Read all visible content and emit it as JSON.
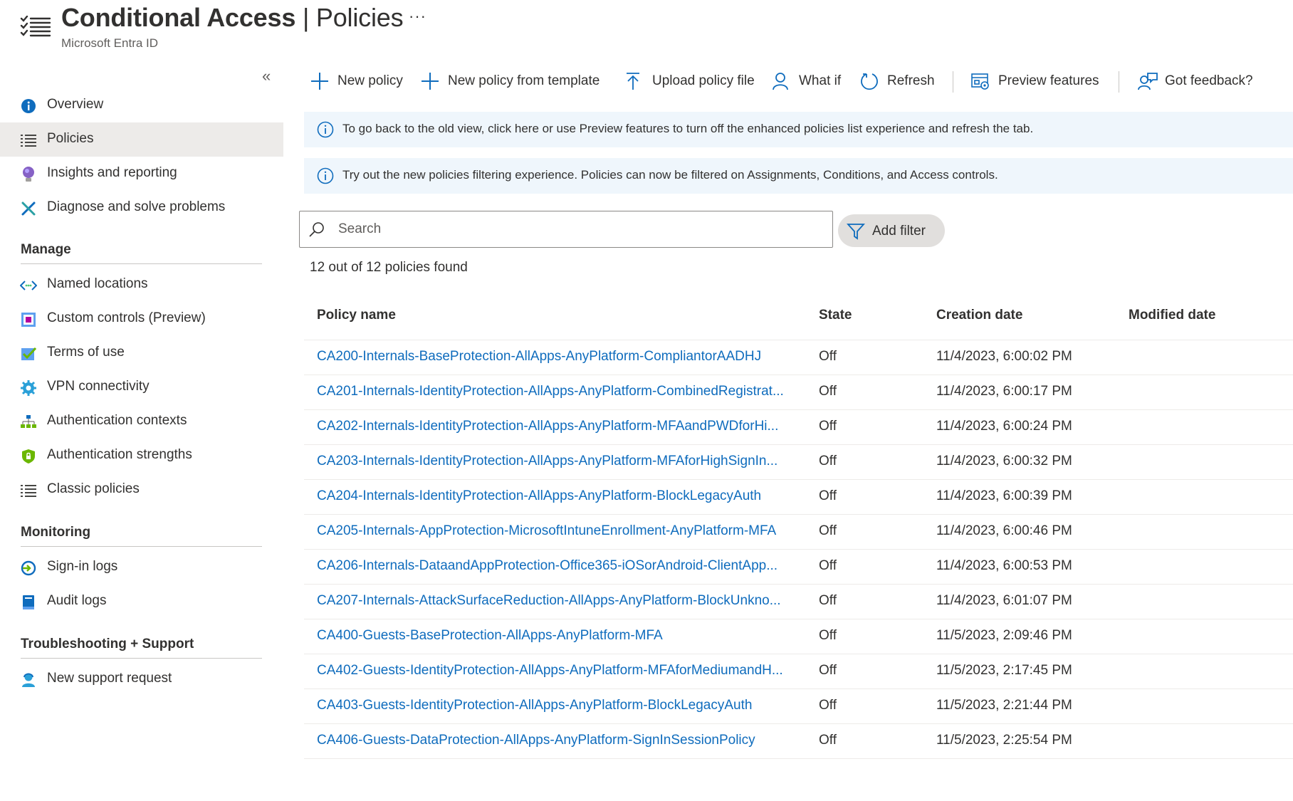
{
  "header": {
    "title_main": "Conditional Access",
    "title_sep": "|",
    "title_page": "Policies",
    "subtitle": "Microsoft Entra ID",
    "more": "···"
  },
  "sidebar": {
    "collapse": "«",
    "top_items": [
      {
        "label": "Overview",
        "icon": "info-icon"
      },
      {
        "label": "Policies",
        "icon": "list-icon",
        "active": true
      },
      {
        "label": "Insights and reporting",
        "icon": "lightbulb-icon"
      },
      {
        "label": "Diagnose and solve problems",
        "icon": "wrench-icon"
      }
    ],
    "sections": [
      {
        "title": "Manage",
        "items": [
          {
            "label": "Named locations",
            "icon": "code-arrows-icon"
          },
          {
            "label": "Custom controls (Preview)",
            "icon": "custom-controls-icon"
          },
          {
            "label": "Terms of use",
            "icon": "checklist-icon"
          },
          {
            "label": "VPN connectivity",
            "icon": "gear-icon"
          },
          {
            "label": "Authentication contexts",
            "icon": "hierarchy-icon"
          },
          {
            "label": "Authentication strengths",
            "icon": "shield-lock-icon"
          },
          {
            "label": "Classic policies",
            "icon": "list-icon"
          }
        ]
      },
      {
        "title": "Monitoring",
        "items": [
          {
            "label": "Sign-in logs",
            "icon": "sign-in-icon"
          },
          {
            "label": "Audit logs",
            "icon": "book-icon"
          }
        ]
      },
      {
        "title": "Troubleshooting + Support",
        "items": [
          {
            "label": "New support request",
            "icon": "support-person-icon"
          }
        ]
      }
    ]
  },
  "toolbar": {
    "new_policy": "New policy",
    "new_from_template": "New policy from template",
    "upload": "Upload policy file",
    "what_if": "What if",
    "refresh": "Refresh",
    "preview": "Preview features",
    "feedback": "Got feedback?"
  },
  "banners": {
    "old_view": "To go back to the old view, click here or use Preview features to turn off the enhanced policies list experience and refresh the tab.",
    "filtering": "Try out the new policies filtering experience. Policies can now be filtered on Assignments, Conditions, and Access controls."
  },
  "search": {
    "placeholder": "Search",
    "value": ""
  },
  "filter": {
    "add_label": "Add filter"
  },
  "results": {
    "count_text": "12 out of 12 policies found"
  },
  "table": {
    "columns": [
      "Policy name",
      "State",
      "Creation date",
      "Modified date"
    ],
    "rows": [
      {
        "name": "CA200-Internals-BaseProtection-AllApps-AnyPlatform-CompliantorAADHJ",
        "state": "Off",
        "created": "11/4/2023, 6:00:02 PM",
        "modified": ""
      },
      {
        "name": "CA201-Internals-IdentityProtection-AllApps-AnyPlatform-CombinedRegistrat...",
        "state": "Off",
        "created": "11/4/2023, 6:00:17 PM",
        "modified": ""
      },
      {
        "name": "CA202-Internals-IdentityProtection-AllApps-AnyPlatform-MFAandPWDforHi...",
        "state": "Off",
        "created": "11/4/2023, 6:00:24 PM",
        "modified": ""
      },
      {
        "name": "CA203-Internals-IdentityProtection-AllApps-AnyPlatform-MFAforHighSignIn...",
        "state": "Off",
        "created": "11/4/2023, 6:00:32 PM",
        "modified": ""
      },
      {
        "name": "CA204-Internals-IdentityProtection-AllApps-AnyPlatform-BlockLegacyAuth",
        "state": "Off",
        "created": "11/4/2023, 6:00:39 PM",
        "modified": ""
      },
      {
        "name": "CA205-Internals-AppProtection-MicrosoftIntuneEnrollment-AnyPlatform-MFA",
        "state": "Off",
        "created": "11/4/2023, 6:00:46 PM",
        "modified": ""
      },
      {
        "name": "CA206-Internals-DataandAppProtection-Office365-iOSorAndroid-ClientApp...",
        "state": "Off",
        "created": "11/4/2023, 6:00:53 PM",
        "modified": ""
      },
      {
        "name": "CA207-Internals-AttackSurfaceReduction-AllApps-AnyPlatform-BlockUnkno...",
        "state": "Off",
        "created": "11/4/2023, 6:01:07 PM",
        "modified": ""
      },
      {
        "name": "CA400-Guests-BaseProtection-AllApps-AnyPlatform-MFA",
        "state": "Off",
        "created": "11/5/2023, 2:09:46 PM",
        "modified": ""
      },
      {
        "name": "CA402-Guests-IdentityProtection-AllApps-AnyPlatform-MFAforMediumandH...",
        "state": "Off",
        "created": "11/5/2023, 2:17:45 PM",
        "modified": ""
      },
      {
        "name": "CA403-Guests-IdentityProtection-AllApps-AnyPlatform-BlockLegacyAuth",
        "state": "Off",
        "created": "11/5/2023, 2:21:44 PM",
        "modified": ""
      },
      {
        "name": "CA406-Guests-DataProtection-AllApps-AnyPlatform-SignInSessionPolicy",
        "state": "Off",
        "created": "11/5/2023, 2:25:54 PM",
        "modified": ""
      }
    ]
  },
  "colors": {
    "accent": "#0f6cbd",
    "banner_bg": "#eff6fc",
    "active_nav_bg": "#edebe9",
    "filter_pill_bg": "#e1dfdd"
  }
}
